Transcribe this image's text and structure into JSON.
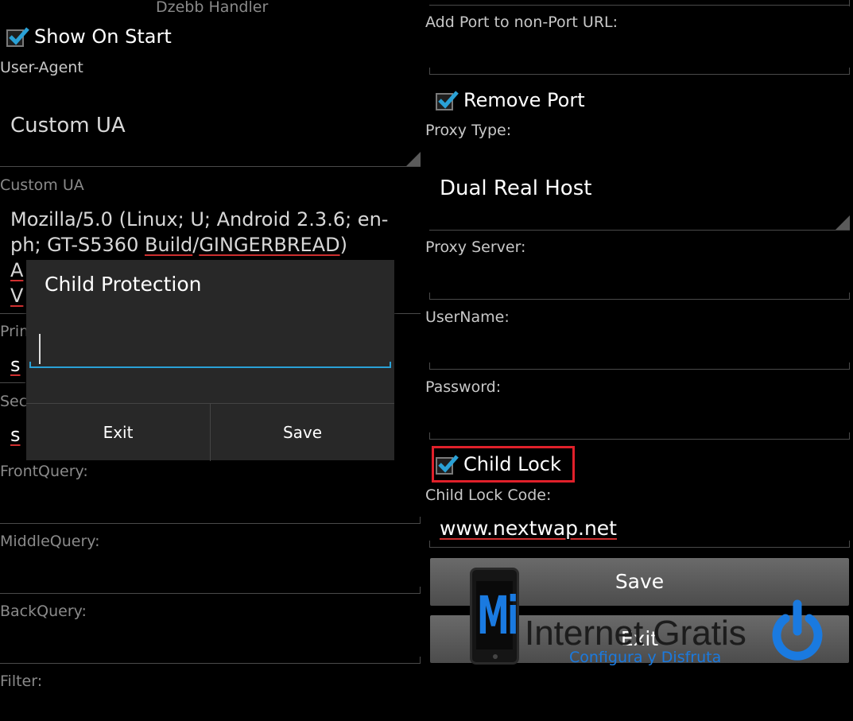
{
  "left": {
    "handler_title": "Dzebb Handler",
    "show_on_start": {
      "label": "Show On Start",
      "checked": true
    },
    "user_agent_label": "User-Agent",
    "user_agent_value": "Custom UA",
    "custom_ua_label": "Custom UA",
    "custom_ua_lines": [
      "Mozilla/5.0 (Linux; U; Android 2.3.6; en-",
      "ph; GT-S5360 ",
      "Build",
      "/",
      "GINGERBREAD",
      ")",
      "A",
      "V"
    ],
    "primary_label": "Prim",
    "primary_value": "s",
    "secondary_label": "Sec",
    "secondary_value": "s",
    "front_query_label": "FrontQuery:",
    "middle_query_label": "MiddleQuery:",
    "back_query_label": "BackQuery:",
    "filter_label": "Filter:"
  },
  "dialog": {
    "title": "Child Protection",
    "input_value": "",
    "exit_label": "Exit",
    "save_label": "Save"
  },
  "right": {
    "add_port_label": "Add Port to non-Port URL:",
    "remove_port": {
      "label": "Remove Port",
      "checked": true
    },
    "proxy_type_label": "Proxy Type:",
    "proxy_type_value": "Dual Real Host",
    "proxy_server_label": "Proxy Server:",
    "username_label": "UserName:",
    "password_label": "Password:",
    "child_lock": {
      "label": "Child Lock",
      "checked": true
    },
    "child_lock_code_label": "Child Lock Code:",
    "child_lock_code_value": "www.nextwap.net",
    "save_label": "Save",
    "exit_label": "Exit"
  },
  "watermark": {
    "mi": "Mi",
    "text": "Internet Gratis",
    "tagline": "Configura y Disfruta"
  },
  "colors": {
    "background": "#000000",
    "accent": "#2aa1d6",
    "highlight_box": "#e0202a",
    "spell_underline": "#d03030",
    "watermark_blue": "#1a7ae0"
  }
}
